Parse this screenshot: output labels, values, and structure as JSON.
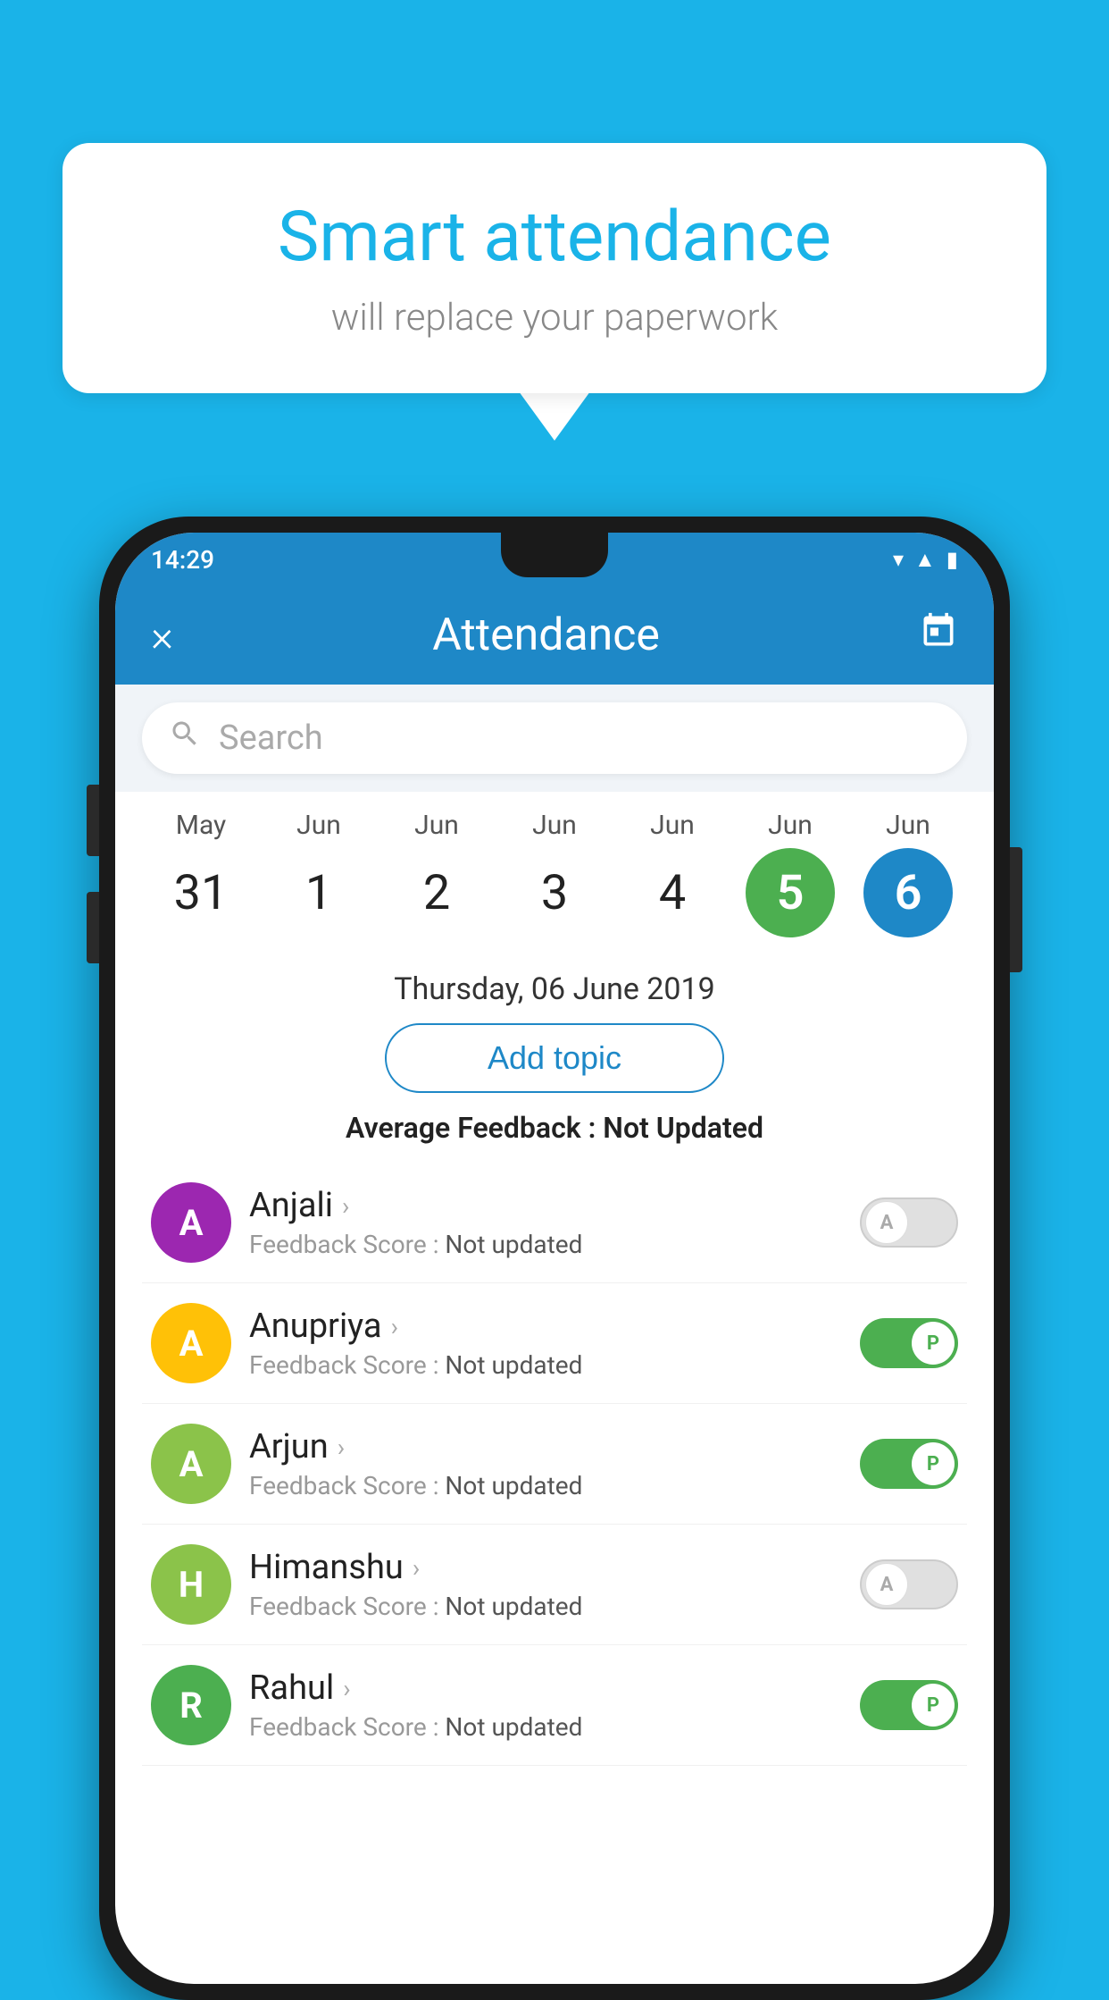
{
  "background_color": "#1ab3e8",
  "speech_bubble": {
    "title": "Smart attendance",
    "subtitle": "will replace your paperwork"
  },
  "phone": {
    "status_bar": {
      "time": "14:29",
      "icons": [
        "wifi",
        "signal",
        "battery"
      ]
    },
    "header": {
      "title": "Attendance",
      "close_label": "×",
      "calendar_icon": "📅"
    },
    "search": {
      "placeholder": "Search"
    },
    "date_strip": {
      "dates": [
        {
          "month": "May",
          "day": "31",
          "state": "normal"
        },
        {
          "month": "Jun",
          "day": "1",
          "state": "normal"
        },
        {
          "month": "Jun",
          "day": "2",
          "state": "normal"
        },
        {
          "month": "Jun",
          "day": "3",
          "state": "normal"
        },
        {
          "month": "Jun",
          "day": "4",
          "state": "normal"
        },
        {
          "month": "Jun",
          "day": "5",
          "state": "today"
        },
        {
          "month": "Jun",
          "day": "6",
          "state": "selected"
        }
      ]
    },
    "selected_date": "Thursday, 06 June 2019",
    "add_topic_label": "Add topic",
    "avg_feedback_label": "Average Feedback :",
    "avg_feedback_value": "Not Updated",
    "students": [
      {
        "name": "Anjali",
        "avatar_letter": "A",
        "avatar_color": "#9c27b0",
        "feedback_label": "Feedback Score :",
        "feedback_value": "Not updated",
        "toggle": "off",
        "toggle_letter": "A"
      },
      {
        "name": "Anupriya",
        "avatar_letter": "A",
        "avatar_color": "#ffc107",
        "feedback_label": "Feedback Score :",
        "feedback_value": "Not updated",
        "toggle": "on",
        "toggle_letter": "P"
      },
      {
        "name": "Arjun",
        "avatar_letter": "A",
        "avatar_color": "#8bc34a",
        "feedback_label": "Feedback Score :",
        "feedback_value": "Not updated",
        "toggle": "on",
        "toggle_letter": "P"
      },
      {
        "name": "Himanshu",
        "avatar_letter": "H",
        "avatar_color": "#8bc34a",
        "feedback_label": "Feedback Score :",
        "feedback_value": "Not updated",
        "toggle": "off",
        "toggle_letter": "A"
      },
      {
        "name": "Rahul",
        "avatar_letter": "R",
        "avatar_color": "#4caf50",
        "feedback_label": "Feedback Score :",
        "feedback_value": "Not updated",
        "toggle": "on",
        "toggle_letter": "P"
      }
    ]
  }
}
